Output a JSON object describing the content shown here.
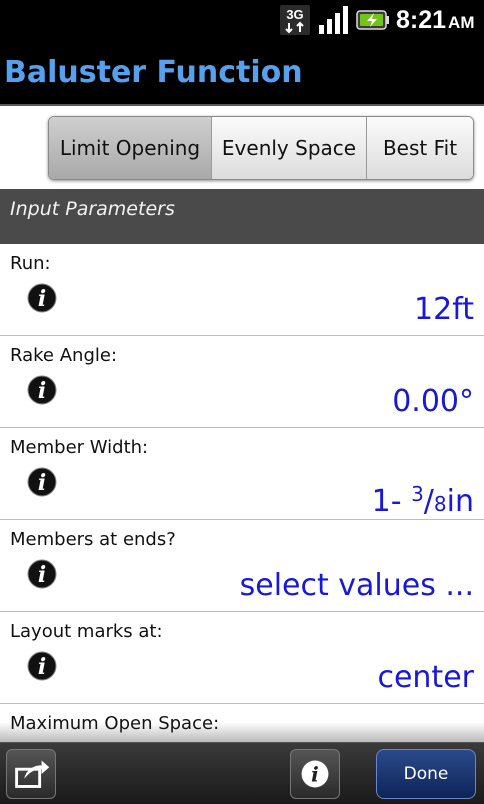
{
  "status_bar": {
    "network": "3G",
    "network_icon": "3g-icon",
    "signal_icon": "signal-icon",
    "battery_icon": "battery-charging-icon",
    "time": "8:21",
    "ampm": "AM"
  },
  "title": "Baluster Function",
  "tabs": [
    {
      "label": "Limit Opening",
      "selected": true
    },
    {
      "label": "Evenly Space",
      "selected": false
    },
    {
      "label": "Best Fit",
      "selected": false
    }
  ],
  "section_header": "Input Parameters",
  "params": [
    {
      "label": "Run:",
      "value": "12ft"
    },
    {
      "label": "Rake Angle:",
      "value": "0.00°"
    },
    {
      "label": "Member Width:",
      "value_whole": "1- ",
      "value_num": "3",
      "value_den": "8",
      "value_unit": "in"
    },
    {
      "label": "Members at ends?",
      "value": "select values ..."
    },
    {
      "label": "Layout marks at:",
      "value": "center"
    },
    {
      "label": "Maximum Open Space:",
      "value": ""
    }
  ],
  "bottom_bar": {
    "share_icon": "share-icon",
    "info_icon": "info-icon",
    "done_label": "Done"
  },
  "colors": {
    "title": "#56a0ee",
    "value": "#1818d8",
    "section_header_bg": "#4a4a4a"
  }
}
